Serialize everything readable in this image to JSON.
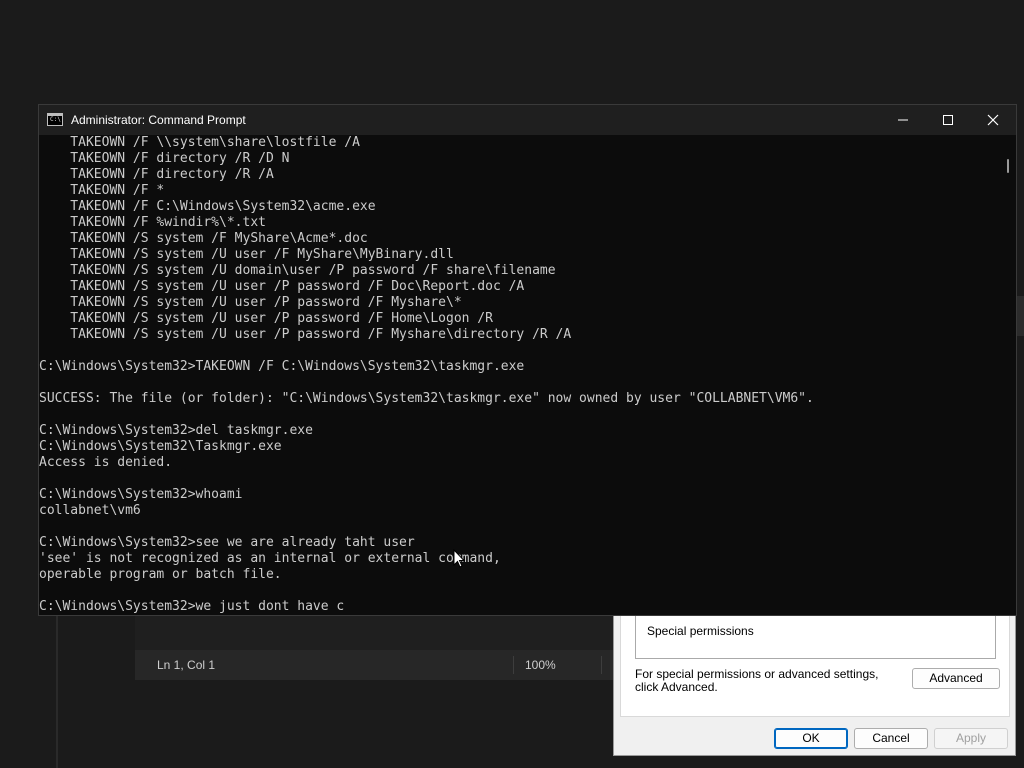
{
  "cmd": {
    "title": "Administrator: Command Prompt",
    "icon_text": "C:\\",
    "lines": [
      "    TAKEOWN /F \\\\system\\share\\lostfile /A",
      "    TAKEOWN /F directory /R /D N",
      "    TAKEOWN /F directory /R /A",
      "    TAKEOWN /F *",
      "    TAKEOWN /F C:\\Windows\\System32\\acme.exe",
      "    TAKEOWN /F %windir%\\*.txt",
      "    TAKEOWN /S system /F MyShare\\Acme*.doc",
      "    TAKEOWN /S system /U user /F MyShare\\MyBinary.dll",
      "    TAKEOWN /S system /U domain\\user /P password /F share\\filename",
      "    TAKEOWN /S system /U user /P password /F Doc\\Report.doc /A",
      "    TAKEOWN /S system /U user /P password /F Myshare\\*",
      "    TAKEOWN /S system /U user /P password /F Home\\Logon /R",
      "    TAKEOWN /S system /U user /P password /F Myshare\\directory /R /A",
      "",
      "C:\\Windows\\System32>TAKEOWN /F C:\\Windows\\System32\\taskmgr.exe",
      "",
      "SUCCESS: The file (or folder): \"C:\\Windows\\System32\\taskmgr.exe\" now owned by user \"COLLABNET\\VM6\".",
      "",
      "C:\\Windows\\System32>del taskmgr.exe",
      "C:\\Windows\\System32\\Taskmgr.exe",
      "Access is denied.",
      "",
      "C:\\Windows\\System32>whoami",
      "collabnet\\vm6",
      "",
      "C:\\Windows\\System32>see we are already taht user",
      "'see' is not recognized as an internal or external command,",
      "operable program or batch file.",
      "",
      "C:\\Windows\\System32>we just dont have c"
    ]
  },
  "notepad": {
    "position": "Ln 1, Col 1",
    "zoom": "100%"
  },
  "permissions": {
    "list_item": "Special permissions",
    "description": "For special permissions or advanced settings, click Advanced.",
    "advanced_label": "Advanced",
    "ok_label": "OK",
    "cancel_label": "Cancel",
    "apply_label": "Apply"
  },
  "icons": {
    "minimize": "minimize-icon",
    "maximize": "maximize-icon",
    "close": "close-icon",
    "pointer": "mouse-pointer-icon"
  }
}
